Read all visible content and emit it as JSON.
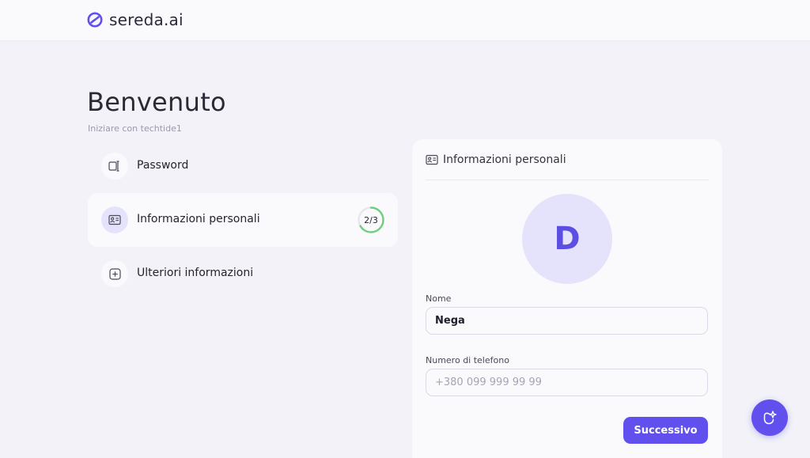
{
  "brand": {
    "name": "sereda.ai",
    "accent": "#6150ee",
    "logo_icon": "sereda-logo-icon"
  },
  "page": {
    "title": "Benvenuto",
    "subtitle": "Iniziare con techtide1"
  },
  "steps": [
    {
      "label": "Password",
      "icon": "password-field-icon"
    },
    {
      "label": "Informazioni personali",
      "icon": "id-card-icon",
      "progress": "2/3",
      "progress_fraction": 0.6667,
      "progress_color": "#6fcf7e"
    },
    {
      "label": "Ulteriori informazioni",
      "icon": "plus-square-icon"
    }
  ],
  "card": {
    "title": "Informazioni personali",
    "avatar_initial": "D",
    "fields": {
      "name": {
        "label": "Nome",
        "value": "Nega"
      },
      "phone": {
        "label": "Numero di telefono",
        "placeholder": "+380 099 999 99 99"
      }
    },
    "next_label": "Successivo"
  },
  "fab": {
    "icon": "assistant-sparkle-icon"
  }
}
